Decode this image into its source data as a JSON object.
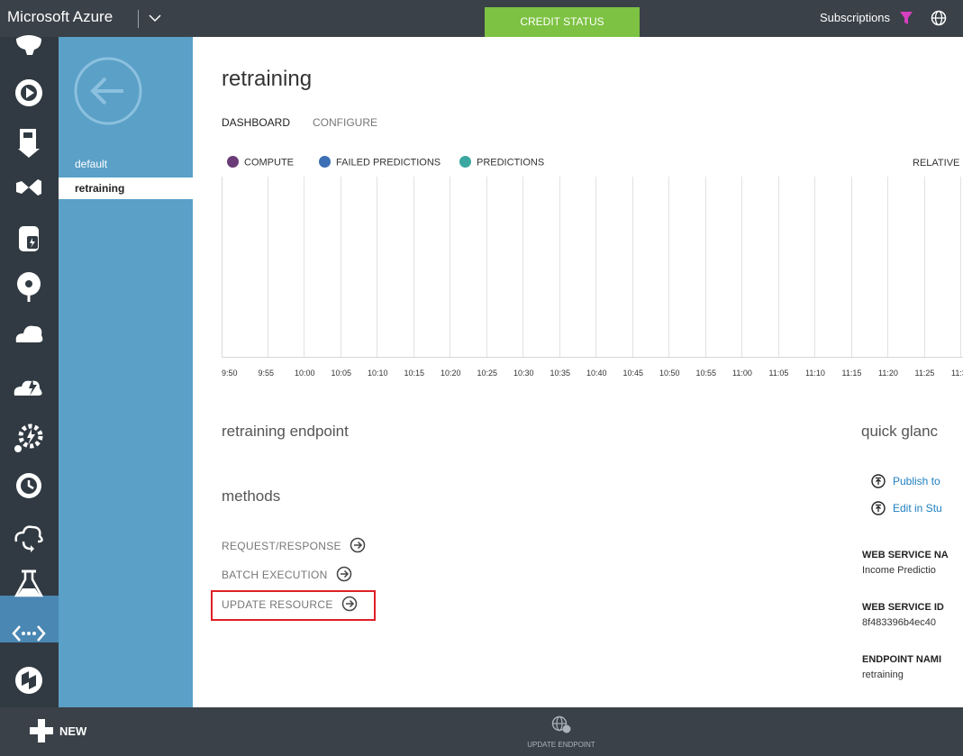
{
  "topbar": {
    "brand": "Microsoft Azure",
    "credit_status": "CREDIT STATUS",
    "subscriptions": "Subscriptions"
  },
  "subnav": {
    "items": [
      {
        "label": "default"
      },
      {
        "label": "retraining"
      }
    ]
  },
  "main": {
    "title": "retraining",
    "tabs": [
      {
        "label": "DASHBOARD"
      },
      {
        "label": "CONFIGURE"
      }
    ],
    "legend": [
      {
        "label": "COMPUTE",
        "color": "#6b3b78"
      },
      {
        "label": "FAILED PREDICTIONS",
        "color": "#3c6fb4"
      },
      {
        "label": "PREDICTIONS",
        "color": "#3aa8a0"
      }
    ],
    "relative_label": "RELATIVE",
    "time_ticks": [
      "9:50",
      "9:55",
      "10:00",
      "10:05",
      "10:10",
      "10:15",
      "10:20",
      "10:25",
      "10:30",
      "10:35",
      "10:40",
      "10:45",
      "10:50",
      "10:55",
      "11:00",
      "11:05",
      "11:10",
      "11:15",
      "11:20",
      "11:25",
      "11:3"
    ],
    "endpoint_title": "retraining endpoint",
    "methods_title": "methods",
    "methods": [
      {
        "label": "REQUEST/RESPONSE"
      },
      {
        "label": "BATCH EXECUTION"
      },
      {
        "label": "UPDATE RESOURCE"
      }
    ],
    "quick_glance": {
      "title": "quick glanc",
      "links": [
        {
          "label": "Publish to"
        },
        {
          "label": "Edit in Stu"
        }
      ],
      "fields": [
        {
          "label": "WEB SERVICE NA",
          "value": "Income Predictio"
        },
        {
          "label": "WEB SERVICE ID",
          "value": "8f483396b4ec40"
        },
        {
          "label": "ENDPOINT NAMI",
          "value": "retraining"
        }
      ]
    }
  },
  "bottombar": {
    "new_label": "NEW",
    "update_endpoint": "UPDATE ENDPOINT"
  },
  "colors": {
    "chrome": "#3a4148",
    "credit_green": "#7dc242",
    "subnav_blue": "#5aa0c7",
    "link_blue": "#1d7fc2",
    "highlight_red": "#e01f26"
  }
}
